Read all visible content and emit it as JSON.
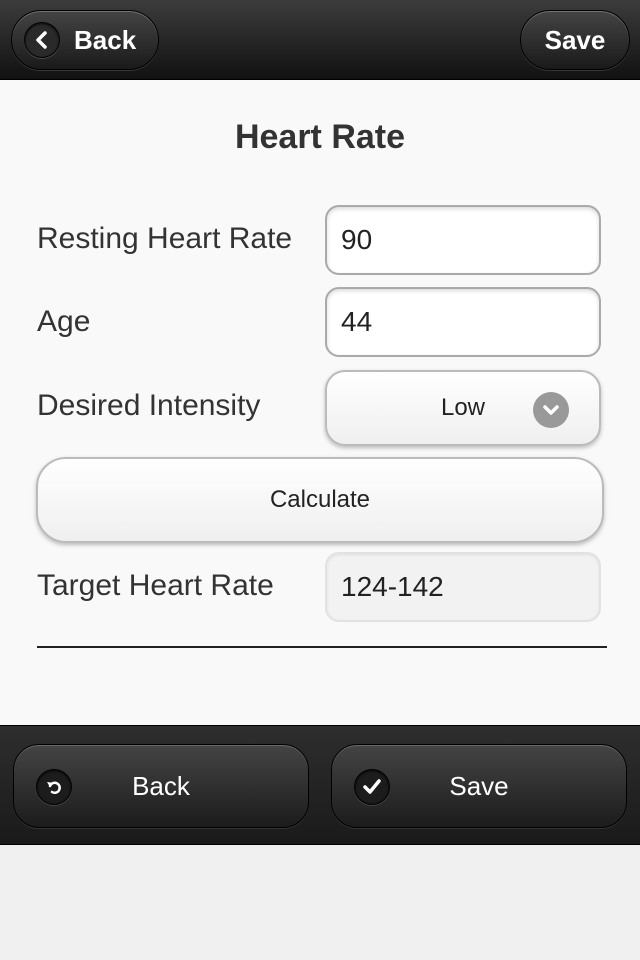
{
  "header": {
    "back_label": "Back",
    "save_label": "Save"
  },
  "page": {
    "title": "Heart Rate"
  },
  "form": {
    "resting_heart_rate": {
      "label": "Resting Heart Rate",
      "value": "90"
    },
    "age": {
      "label": "Age",
      "value": "44"
    },
    "desired_intensity": {
      "label": "Desired Intensity",
      "selected": "Low"
    },
    "calculate_label": "Calculate",
    "target_heart_rate": {
      "label": "Target Heart Rate",
      "value": "124-142"
    }
  },
  "footer": {
    "back_label": "Back",
    "save_label": "Save"
  },
  "icons": {
    "header_back": "chevron-left-icon",
    "select": "chevron-down-icon",
    "footer_back": "undo-arrow-icon",
    "footer_save": "checkmark-icon"
  }
}
